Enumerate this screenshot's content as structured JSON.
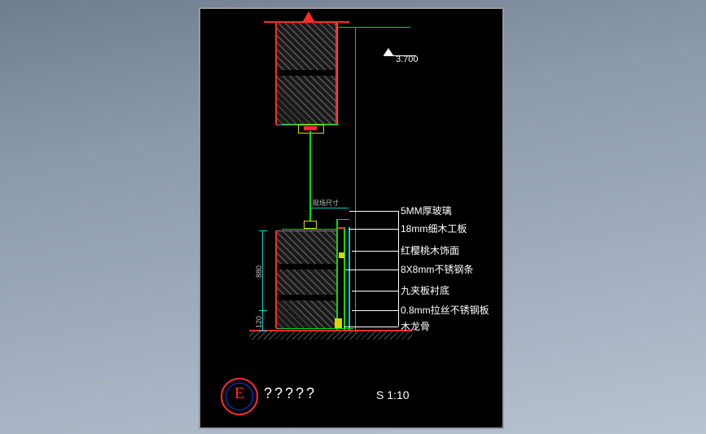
{
  "chart_data": {
    "type": "table",
    "title": "E ?????",
    "scale": "S 1:10",
    "elevation": "3.700",
    "in_situ": "现场尺寸",
    "dims": {
      "upper": "880",
      "lower": "120"
    },
    "annotations": [
      "5MM厚玻璃",
      "18mm细木工板",
      "红樱桃木饰面",
      "8X8mm不锈钢条",
      "九夹板衬底",
      "0.8mm拉丝不锈钢板",
      "木龙骨"
    ]
  },
  "elev_label": "3.700",
  "insitu": "现场尺寸",
  "a": {
    "glass": "5MM厚玻璃",
    "ply18": "18mm细木工板",
    "cherry": "红樱桃木饰面",
    "ss8x8": "8X8mm不锈钢条",
    "nine": "九夹板衬底",
    "ss08": "0.8mm拉丝不锈钢板",
    "keel": "木龙骨"
  },
  "dim880": "880",
  "dim120": "120",
  "sym": "E",
  "title": "?????",
  "scale": "S 1:10"
}
